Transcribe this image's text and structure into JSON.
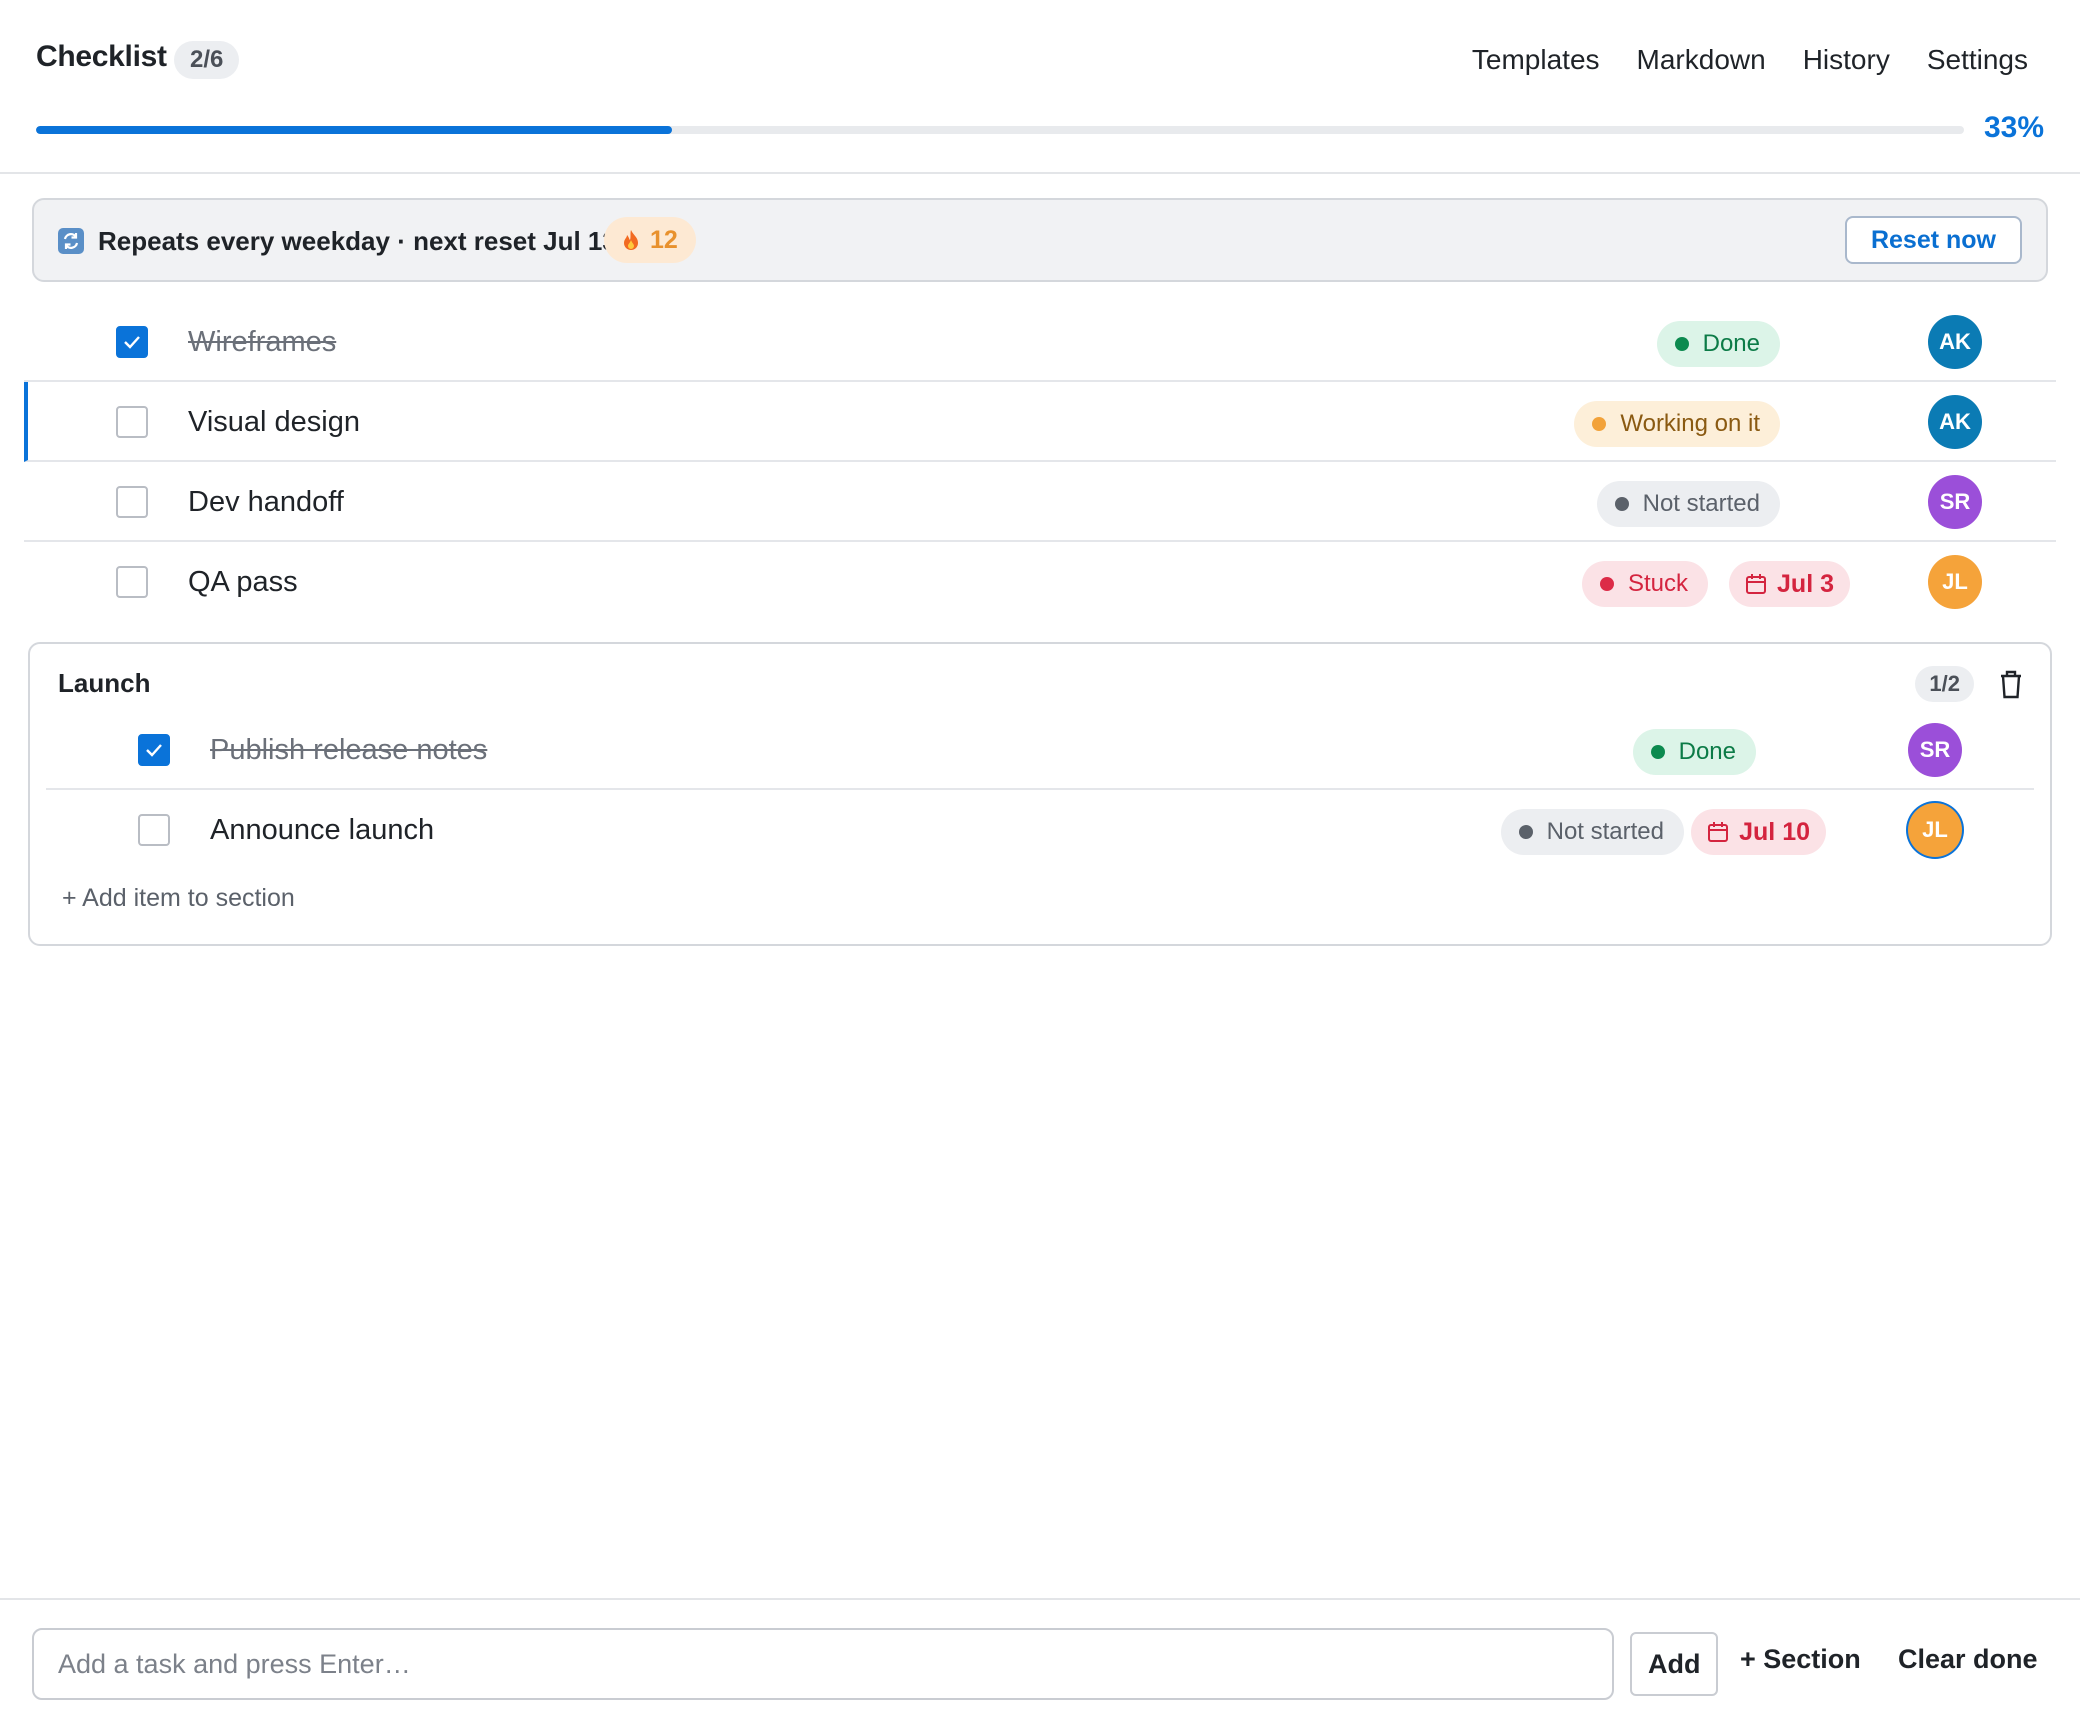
{
  "header": {
    "title": "Checklist",
    "count": "2/6",
    "nav": [
      "Templates",
      "Markdown",
      "History",
      "Settings"
    ],
    "progress_percent": 33,
    "progress_label": "33%"
  },
  "banner": {
    "text": "Repeats every weekday · next reset Jul 13",
    "streak_count": "12",
    "reset_label": "Reset now"
  },
  "tasks": [
    {
      "label": "Wireframes",
      "done": true,
      "status": "Done",
      "assignee": "AK"
    },
    {
      "label": "Visual design",
      "done": false,
      "status": "Working on it",
      "assignee": "AK"
    },
    {
      "label": "Dev handoff",
      "done": false,
      "status": "Not started",
      "assignee": "SR"
    },
    {
      "label": "QA pass",
      "done": false,
      "status": "Stuck",
      "due": "Jul 3",
      "assignee": "JL"
    }
  ],
  "section": {
    "title": "Launch",
    "count": "1/2",
    "items": [
      {
        "label": "Publish release notes",
        "done": true,
        "status": "Done",
        "assignee": "SR"
      },
      {
        "label": "Announce launch",
        "done": false,
        "status": "Not started",
        "due": "Jul 10",
        "assignee": "JL"
      }
    ],
    "add_label": "+ Add item to section"
  },
  "footer": {
    "input_placeholder": "Add a task and press Enter…",
    "add_label": "Add",
    "section_label": "+ Section",
    "clear_label": "Clear done"
  },
  "colors": {
    "accent": "#0a73d9",
    "done": "#0c8a4f",
    "working": "#f2a23a",
    "stuck": "#dc2b47",
    "not_started": "#5b616a"
  }
}
